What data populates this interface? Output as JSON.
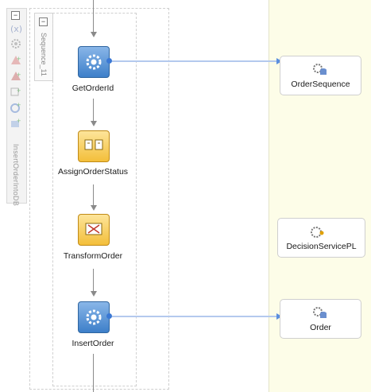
{
  "toolbar": {
    "label": "InsertOrderIntoDB",
    "collapse": "−",
    "icons": [
      "variable-icon",
      "gear-icon",
      "add-icon",
      "add-icon",
      "add-icon",
      "add-icon",
      "add-icon"
    ]
  },
  "sequence": {
    "label": "Sequence_11",
    "collapse": "−"
  },
  "activities": [
    {
      "label": "GetOrderId",
      "kind": "invoke"
    },
    {
      "label": "AssignOrderStatus",
      "kind": "assign"
    },
    {
      "label": "TransformOrder",
      "kind": "transform"
    },
    {
      "label": "InsertOrder",
      "kind": "invoke"
    }
  ],
  "partner_links": [
    {
      "label": "OrderSequence"
    },
    {
      "label": "DecisionServicePL"
    },
    {
      "label": "Order"
    }
  ],
  "colors": {
    "lane": "#fdfde8",
    "invoke": "#3d7fc9",
    "assign": "#f3bf3a",
    "wire": "#b4c9ee"
  }
}
